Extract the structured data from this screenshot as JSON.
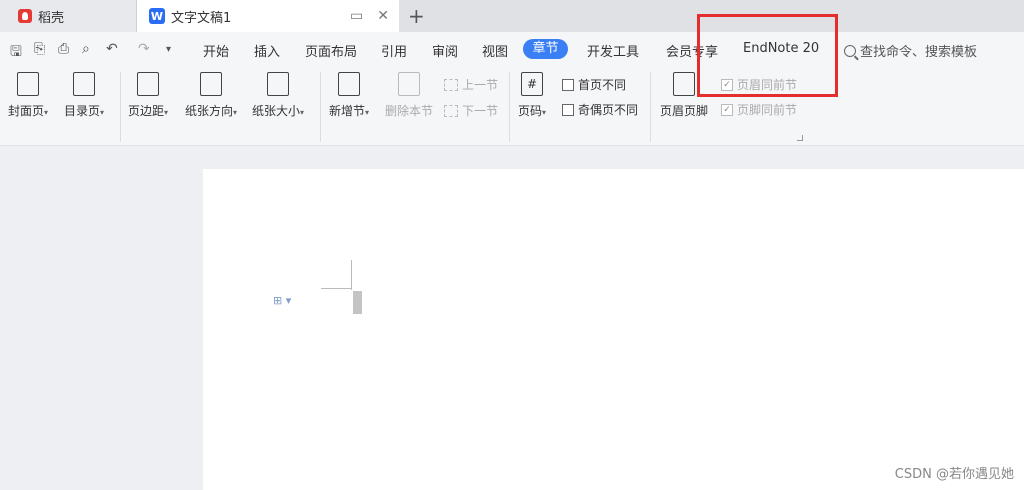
{
  "tabs": {
    "daoke": "稻壳",
    "document": "文字文稿1"
  },
  "menu": {
    "items": [
      "开始",
      "插入",
      "页面布局",
      "引用",
      "审阅",
      "视图"
    ],
    "active": "章节",
    "items_after": [
      "开发工具",
      "会员专享",
      "EndNote 20"
    ],
    "search_placeholder": "查找命令、搜索模板"
  },
  "ribbon": {
    "cover_page": "封面页",
    "toc_page": "目录页",
    "margins": "页边距",
    "orientation": "纸张方向",
    "paper_size": "纸张大小",
    "add_section": "新增节",
    "delete_section": "删除本节",
    "prev_section": "上一节",
    "next_section": "下一节",
    "page_number": "页码",
    "first_page_diff": "首页不同",
    "odd_even_diff": "奇偶页不同",
    "header_footer": "页眉页脚",
    "header_same_prev": "页眉同前节",
    "footer_same_prev": "页脚同前节"
  },
  "watermark": "CSDN @若你遇见她",
  "colors": {
    "accent": "#3b7ff5",
    "highlight": "#e52d2d"
  }
}
